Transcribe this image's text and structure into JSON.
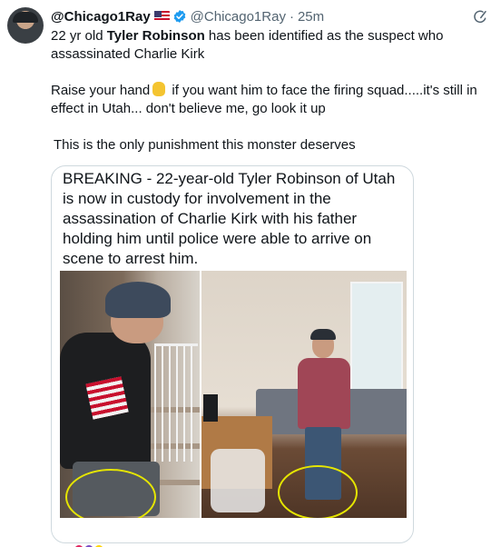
{
  "post": {
    "display_name": "@Chicago1Ray",
    "handle": "@Chicago1Ray",
    "separator": "·",
    "time": "25m",
    "line1_a": "22 yr old ",
    "line1_bold": "Tyler Robinson",
    "line1_b": " has been identified as the suspect who assassinated Charlie Kirk",
    "line2_a": "Raise your hand",
    "line2_b": "if you want him to face the firing squad.....it's still in effect in Utah... don't believe me, go look it up",
    "line3": "This is the only punishment this monster deserves"
  },
  "quote": {
    "text": "BREAKING - 22-year-old Tyler Robinson of Utah is now in custody for involvement in the assassination of Charlie Kirk with his father holding him until police were able to arrive on scene to arrest him."
  },
  "icons": [
    "avatar",
    "us-flag-icon",
    "verified-badge-icon",
    "grok-icon",
    "raised-hand-emoji-icon"
  ],
  "colors": {
    "text": "#0f1419",
    "muted": "#536471",
    "verified": "#1d9bf0",
    "border": "#cfd9de",
    "highlight_circle": "#e5e500"
  }
}
